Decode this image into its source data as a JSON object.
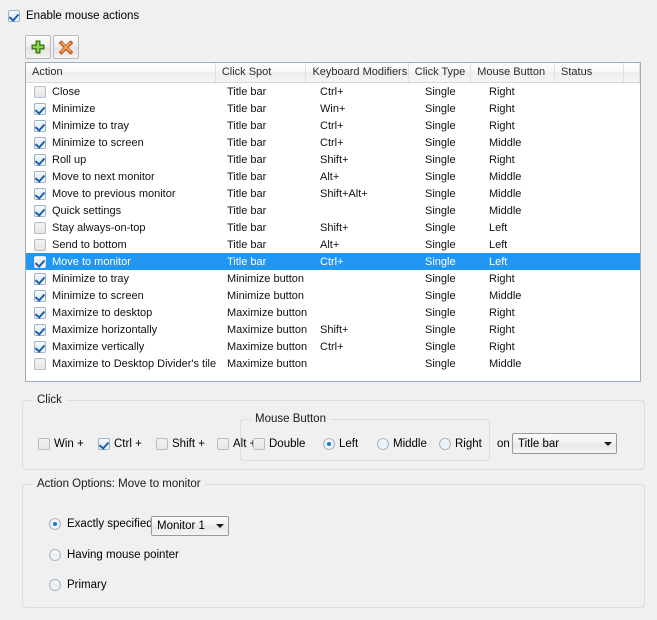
{
  "enable": {
    "label": "Enable mouse actions",
    "checked": true
  },
  "toolbar": {
    "add": {
      "name": "add-action-button",
      "icon": "plus-icon"
    },
    "delete": {
      "name": "delete-action-button",
      "icon": "delete-x-icon"
    }
  },
  "grid": {
    "columns": [
      "Action",
      "Click Spot",
      "Keyboard Modifiers",
      "Click Type",
      "Mouse Button",
      "Status"
    ],
    "rows": [
      {
        "checked": false,
        "action": "Close",
        "spot": "Title bar",
        "mods": "Ctrl+",
        "type": "Single",
        "button": "Right",
        "status": "",
        "selected": false
      },
      {
        "checked": true,
        "action": "Minimize",
        "spot": "Title bar",
        "mods": "Win+",
        "type": "Single",
        "button": "Right",
        "status": "",
        "selected": false
      },
      {
        "checked": true,
        "action": "Minimize to tray",
        "spot": "Title bar",
        "mods": "Ctrl+",
        "type": "Single",
        "button": "Right",
        "status": "",
        "selected": false
      },
      {
        "checked": true,
        "action": "Minimize to screen",
        "spot": "Title bar",
        "mods": "Ctrl+",
        "type": "Single",
        "button": "Middle",
        "status": "",
        "selected": false
      },
      {
        "checked": true,
        "action": "Roll up",
        "spot": "Title bar",
        "mods": "Shift+",
        "type": "Single",
        "button": "Right",
        "status": "",
        "selected": false
      },
      {
        "checked": true,
        "action": "Move to next monitor",
        "spot": "Title bar",
        "mods": "Alt+",
        "type": "Single",
        "button": "Middle",
        "status": "",
        "selected": false
      },
      {
        "checked": true,
        "action": "Move to previous monitor",
        "spot": "Title bar",
        "mods": "Shift+Alt+",
        "type": "Single",
        "button": "Middle",
        "status": "",
        "selected": false
      },
      {
        "checked": true,
        "action": "Quick settings",
        "spot": "Title bar",
        "mods": "",
        "type": "Single",
        "button": "Middle",
        "status": "",
        "selected": false
      },
      {
        "checked": false,
        "action": "Stay always-on-top",
        "spot": "Title bar",
        "mods": "Shift+",
        "type": "Single",
        "button": "Left",
        "status": "",
        "selected": false
      },
      {
        "checked": false,
        "action": "Send to bottom",
        "spot": "Title bar",
        "mods": "Alt+",
        "type": "Single",
        "button": "Left",
        "status": "",
        "selected": false
      },
      {
        "checked": true,
        "action": "Move to monitor",
        "spot": "Title bar",
        "mods": "Ctrl+",
        "type": "Single",
        "button": "Left",
        "status": "",
        "selected": true
      },
      {
        "checked": true,
        "action": "Minimize to tray",
        "spot": "Minimize button",
        "mods": "",
        "type": "Single",
        "button": "Right",
        "status": "",
        "selected": false
      },
      {
        "checked": true,
        "action": "Minimize to screen",
        "spot": "Minimize button",
        "mods": "",
        "type": "Single",
        "button": "Middle",
        "status": "",
        "selected": false
      },
      {
        "checked": true,
        "action": "Maximize to desktop",
        "spot": "Maximize button",
        "mods": "",
        "type": "Single",
        "button": "Right",
        "status": "",
        "selected": false
      },
      {
        "checked": true,
        "action": "Maximize horizontally",
        "spot": "Maximize button",
        "mods": "Shift+",
        "type": "Single",
        "button": "Right",
        "status": "",
        "selected": false
      },
      {
        "checked": true,
        "action": "Maximize vertically",
        "spot": "Maximize button",
        "mods": "Ctrl+",
        "type": "Single",
        "button": "Right",
        "status": "",
        "selected": false
      },
      {
        "checked": false,
        "action": "Maximize to Desktop Divider's tile",
        "spot": "Maximize button",
        "mods": "",
        "type": "Single",
        "button": "Middle",
        "status": "",
        "selected": false
      }
    ]
  },
  "click_group": {
    "title": "Click",
    "modifiers": [
      {
        "label": "Win +",
        "checked": false
      },
      {
        "label": "Ctrl +",
        "checked": true
      },
      {
        "label": "Shift +",
        "checked": false
      },
      {
        "label": "Alt +",
        "checked": false
      }
    ],
    "mouse_button": {
      "title": "Mouse Button",
      "double": {
        "label": "Double",
        "checked": false
      },
      "options": [
        {
          "label": "Left",
          "selected": true
        },
        {
          "label": "Middle",
          "selected": false
        },
        {
          "label": "Right",
          "selected": false
        }
      ]
    },
    "on_label": "on",
    "click_spot": {
      "value": "Title bar"
    }
  },
  "options_group": {
    "title": "Action Options: Move to monitor",
    "items": [
      {
        "label": "Exactly specified",
        "selected": true
      },
      {
        "label": "Having mouse pointer",
        "selected": false
      },
      {
        "label": "Primary",
        "selected": false
      }
    ],
    "monitor": {
      "value": "Monitor 1"
    }
  },
  "colors": {
    "selection": "#2196f3",
    "background": "#f0f0f0",
    "accent_check": "#1b60b0"
  }
}
